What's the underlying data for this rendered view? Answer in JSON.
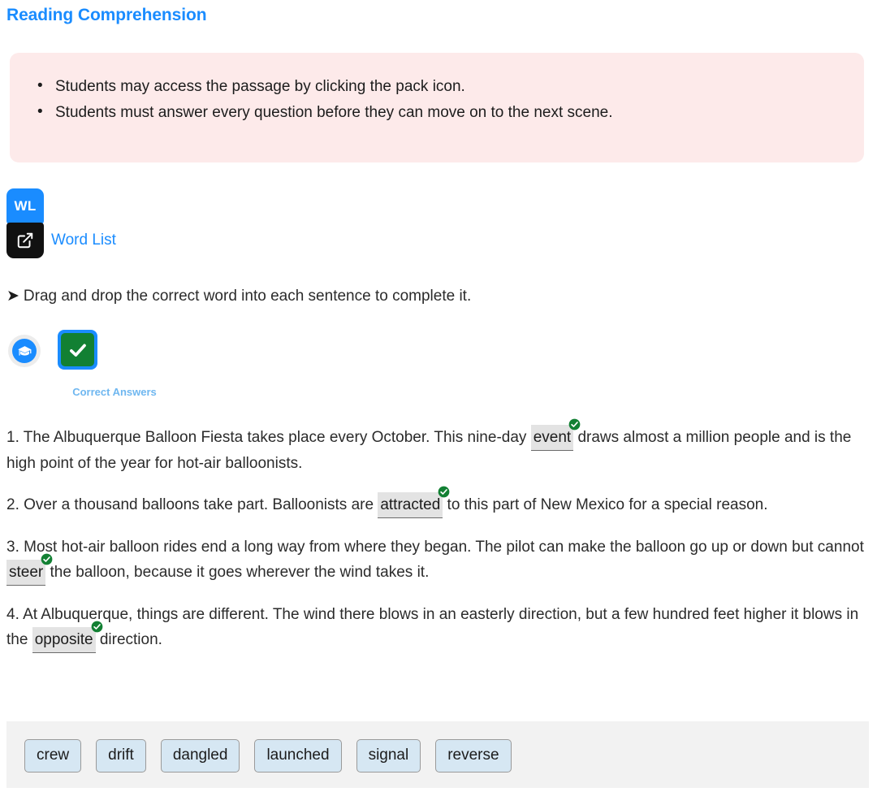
{
  "page": {
    "title": "Reading Comprehension",
    "accent_color": "#1a8cff",
    "notes_bg_color": "#fdeaea",
    "word_bank_bg_color": "#f2f2f2",
    "word_tile_color": "#d6e7f3",
    "correct_green": "#128033"
  },
  "notes": {
    "items": [
      "Students may access the passage by clicking the pack icon.",
      "Students must answer every question before they can move on to the next scene."
    ]
  },
  "word_list": {
    "badge_text": "WL",
    "open_icon": "external-link-icon",
    "label": "Word List"
  },
  "drag_instruction": {
    "arrow": "➤",
    "text": "Drag and drop the correct word into each sentence to complete it."
  },
  "tools": {
    "cap_icon": "graduation-cap-icon",
    "correct_icon": "check-icon",
    "correct_label": "Correct Answers"
  },
  "questions": [
    {
      "number": "1.",
      "before": "1. The Albuquerque Balloon Fiesta takes place every October. This nine-day ",
      "answer": "event",
      "after": " draws almost a million people and is the high point of the year for hot-air balloonists."
    },
    {
      "number": "2.",
      "before": "2. Over a thousand balloons take part. Balloonists are ",
      "answer": "attracted",
      "after": " to this part of New Mexico for a special reason."
    },
    {
      "number": "3.",
      "before": "3. Most hot-air balloon rides end a long way from where they began. The pilot can make the balloon go up or down but cannot ",
      "answer": "steer",
      "after": " the balloon, because it goes wherever the wind takes it."
    },
    {
      "number": "4.",
      "before": "4. At Albuquerque, things are different. The wind there blows in an easterly direction, but a few hundred feet higher it blows in the ",
      "answer": "opposite",
      "after": " direction."
    }
  ],
  "word_bank": {
    "words": [
      "crew",
      "drift",
      "dangled",
      "launched",
      "signal",
      "reverse"
    ]
  }
}
